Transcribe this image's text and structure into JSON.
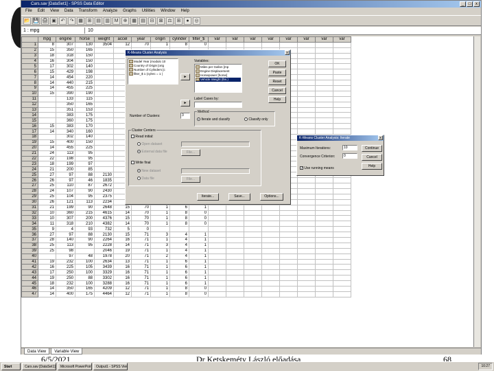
{
  "window": {
    "title": "Cars.sav [DataSet1] - SPSS Data Editor",
    "min": "_",
    "max": "□",
    "close": "x"
  },
  "menu": [
    "File",
    "Edit",
    "View",
    "Data",
    "Transform",
    "Analyze",
    "Graphs",
    "Utilities",
    "Window",
    "Help"
  ],
  "toolbar": [
    "📂",
    "💾",
    "🖨",
    "▣",
    "↶",
    "↷",
    "▦",
    "⊞",
    "▤",
    "▥",
    "M",
    "⊕",
    "▦",
    "▤",
    "⊟",
    "⊠",
    "⚖",
    "⊞",
    "●",
    "◎"
  ],
  "cellbar": {
    "ref": "1 : mpg",
    "value": "10"
  },
  "grid": {
    "columns": [
      "mpg",
      "engine",
      "horse",
      "weight",
      "accel",
      "year",
      "origin",
      "cylinder",
      "filter_$",
      "var",
      "var",
      "var",
      "var",
      "var",
      "var",
      "var",
      "var"
    ],
    "rows": [
      [
        "1",
        "8",
        "307",
        "130",
        "3504",
        "12",
        "70",
        "1",
        "8",
        "0"
      ],
      [
        "2",
        "15",
        "350",
        "165",
        "",
        "",
        "",
        "",
        "",
        ""
      ],
      [
        "3",
        "18",
        "318",
        "150",
        "",
        "",
        "",
        "",
        "",
        ""
      ],
      [
        "4",
        "16",
        "304",
        "150",
        "",
        "",
        "",
        "",
        "",
        ""
      ],
      [
        "5",
        "17",
        "302",
        "140",
        "",
        "",
        "",
        "",
        "",
        ""
      ],
      [
        "6",
        "15",
        "429",
        "198",
        "",
        "",
        "",
        "",
        "",
        ""
      ],
      [
        "7",
        "14",
        "454",
        "220",
        "",
        "",
        "",
        "",
        "",
        ""
      ],
      [
        "8",
        "14",
        "440",
        "215",
        "",
        "",
        "",
        "",
        "",
        ""
      ],
      [
        "9",
        "14",
        "455",
        "225",
        "",
        "",
        "",
        "",
        "",
        ""
      ],
      [
        "10",
        "15",
        "390",
        "190",
        "",
        "",
        "",
        "",
        "",
        ""
      ],
      [
        "11",
        "",
        "133",
        "115",
        "",
        "",
        "",
        "",
        "",
        ""
      ],
      [
        "12",
        "",
        "350",
        "165",
        "",
        "",
        "",
        "",
        "",
        ""
      ],
      [
        "13",
        "",
        "351",
        "153",
        "",
        "",
        "",
        "",
        "",
        ""
      ],
      [
        "14",
        "",
        "383",
        "175",
        "",
        "",
        "",
        "",
        "",
        ""
      ],
      [
        "15",
        "",
        "360",
        "175",
        "",
        "",
        "",
        "",
        "",
        ""
      ],
      [
        "16",
        "15",
        "383",
        "170",
        "",
        "",
        "",
        "",
        "",
        ""
      ],
      [
        "17",
        "14",
        "340",
        "160",
        "",
        "",
        "",
        "",
        "",
        ""
      ],
      [
        "18",
        "",
        "302",
        "140",
        "",
        "",
        "",
        "",
        "",
        ""
      ],
      [
        "19",
        "15",
        "400",
        "150",
        "",
        "",
        "",
        "",
        "",
        ""
      ],
      [
        "20",
        "14",
        "455",
        "225",
        "",
        "",
        "",
        "",
        "",
        ""
      ],
      [
        "21",
        "24",
        "113",
        "95",
        "",
        "",
        "",
        "",
        "",
        ""
      ],
      [
        "22",
        "22",
        "198",
        "95",
        "",
        "",
        "",
        "",
        "",
        ""
      ],
      [
        "23",
        "18",
        "199",
        "97",
        "",
        "",
        "",
        "",
        "",
        ""
      ],
      [
        "24",
        "21",
        "200",
        "85",
        "",
        "",
        "",
        "",
        "",
        ""
      ],
      [
        "25",
        "27",
        "97",
        "88",
        "2130",
        "15",
        "70",
        "3",
        "4",
        "1"
      ],
      [
        "26",
        "26",
        "97",
        "46",
        "1835",
        "21",
        "70",
        "2",
        "4",
        "1"
      ],
      [
        "27",
        "25",
        "110",
        "87",
        "2672",
        "18",
        "70",
        "2",
        "4",
        "1"
      ],
      [
        "28",
        "24",
        "107",
        "90",
        "2430",
        "15",
        "70",
        "2",
        "4",
        "1"
      ],
      [
        "29",
        "25",
        "104",
        "95",
        "2375",
        "18",
        "70",
        "2",
        "4",
        "1"
      ],
      [
        "30",
        "26",
        "121",
        "113",
        "2234",
        "13",
        "70",
        "2",
        "4",
        "1"
      ],
      [
        "31",
        "21",
        "199",
        "90",
        "2648",
        "15",
        "70",
        "1",
        "6",
        "1"
      ],
      [
        "32",
        "10",
        "360",
        "215",
        "4615",
        "14",
        "70",
        "1",
        "8",
        "0"
      ],
      [
        "33",
        "10",
        "307",
        "200",
        "4376",
        "15",
        "70",
        "1",
        "8",
        "0"
      ],
      [
        "34",
        "11",
        "318",
        "210",
        "4382",
        "14",
        "70",
        "1",
        "8",
        "0"
      ],
      [
        "35",
        "9",
        "4",
        "93",
        "732",
        "5",
        "0",
        "",
        "",
        ""
      ],
      [
        "36",
        "27",
        "97",
        "88",
        "2130",
        "15",
        "71",
        "3",
        "4",
        "1"
      ],
      [
        "37",
        "28",
        "140",
        "90",
        "2264",
        "16",
        "71",
        "1",
        "4",
        "1"
      ],
      [
        "38",
        "25",
        "113",
        "95",
        "2228",
        "14",
        "71",
        "3",
        "4",
        "1"
      ],
      [
        "39",
        "25",
        "98",
        "",
        "2046",
        "19",
        "71",
        "1",
        "4",
        "1"
      ],
      [
        "40",
        "",
        "97",
        "48",
        "1978",
        "20",
        "71",
        "2",
        "4",
        "1"
      ],
      [
        "41",
        "19",
        "232",
        "100",
        "2634",
        "13",
        "71",
        "1",
        "6",
        "1"
      ],
      [
        "42",
        "16",
        "225",
        "105",
        "3439",
        "16",
        "71",
        "1",
        "6",
        "1"
      ],
      [
        "43",
        "17",
        "250",
        "100",
        "3329",
        "16",
        "71",
        "1",
        "6",
        "1"
      ],
      [
        "44",
        "19",
        "250",
        "88",
        "3302",
        "16",
        "71",
        "1",
        "6",
        "1"
      ],
      [
        "45",
        "18",
        "232",
        "100",
        "3288",
        "16",
        "71",
        "1",
        "6",
        "1"
      ],
      [
        "46",
        "14",
        "350",
        "165",
        "4209",
        "12",
        "71",
        "1",
        "8",
        "0"
      ],
      [
        "47",
        "14",
        "400",
        "175",
        "4464",
        "12",
        "71",
        "1",
        "8",
        "0"
      ]
    ]
  },
  "tabs": [
    "Data View",
    "Variable View"
  ],
  "kmeans": {
    "title": "K-Means Cluster Analysis",
    "close": "x",
    "source_vars": [
      "Model Year (modulo 10",
      "Country of Origin [orig",
      "Number of Cylinders [c",
      "filter_$ 1 (cylrec = 1 |"
    ],
    "variables_label": "Variables:",
    "variables": [
      "Miles per Gallon [mp",
      "Engine Displacement",
      "Horsepower [horse]",
      "Vehicle Weight (lbs.)"
    ],
    "label_cases": "Label Cases by:",
    "num_clusters_label": "Number of Clusters:",
    "num_clusters": "3",
    "method_label": "Method",
    "method_iterate": "Iterate and classify",
    "method_classify": "Classify only",
    "centers_label": "Cluster Centers",
    "read_initial": "Read initial:",
    "open_dataset": "Open dataset",
    "external_file": "External data file",
    "write_final": "Write final",
    "new_dataset": "New dataset",
    "data_file": "Data file",
    "file_btn": "File...",
    "buttons": [
      "OK",
      "Paste",
      "Reset",
      "Cancel",
      "Help"
    ],
    "bottom_buttons": [
      "Iterate...",
      "Save...",
      "Options..."
    ],
    "arrow": "►"
  },
  "iterate": {
    "title": "K-Means Cluster Analysis: Iterate",
    "close": "x",
    "max_iter_label": "Maximum Iterations:",
    "max_iter": "10",
    "conv_label": "Convergence Criterion:",
    "conv": "0",
    "running_means": "Use running means",
    "buttons": [
      "Continue",
      "Cancel",
      "Help"
    ]
  },
  "footer": {
    "date": "6/5/2021",
    "center": "Dr Ketskeméty László előadása",
    "page": "68"
  },
  "taskbar": {
    "start": "Start",
    "tasks": [
      "Cars.sav [DataSet1]",
      "Microsoft PowerPoint",
      "Output1 - SPSS Viewer"
    ],
    "clock": "10:27"
  }
}
